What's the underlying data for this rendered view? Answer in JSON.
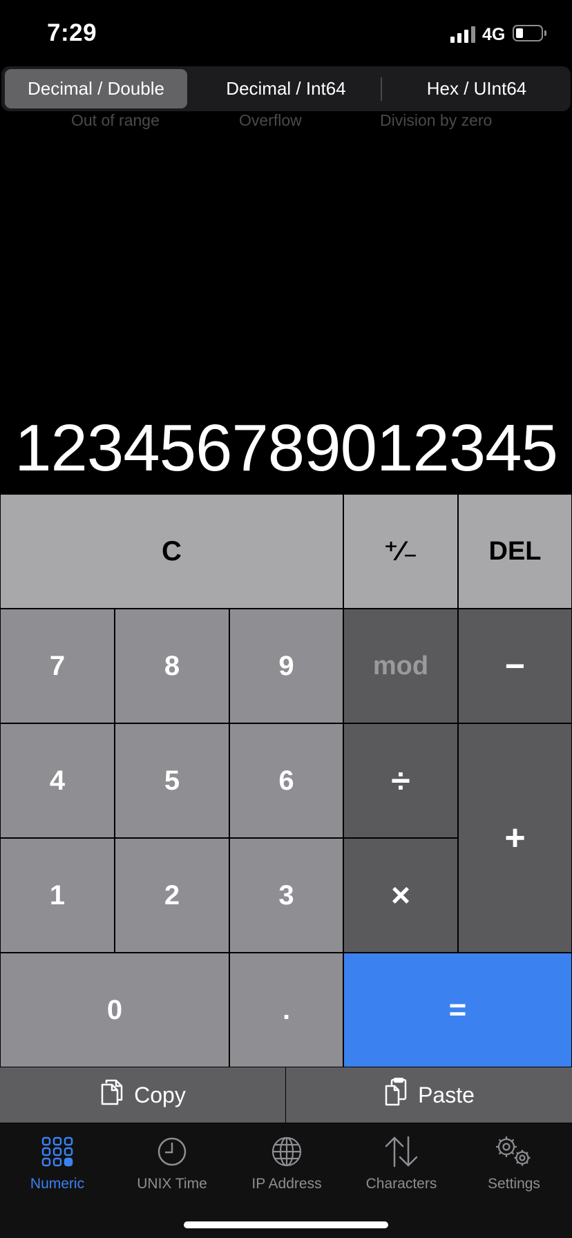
{
  "status_bar": {
    "time": "7:29",
    "network": "4G"
  },
  "segments": {
    "options": [
      "Decimal / Double",
      "Decimal / Int64",
      "Hex / UInt64"
    ],
    "selected": "Decimal / Double"
  },
  "errors": [
    "Out of range",
    "Overflow",
    "Division by zero"
  ],
  "display": {
    "value": "123456789012345"
  },
  "keys": {
    "clear": "C",
    "sign": "⁺∕₋",
    "del": "DEL",
    "seven": "7",
    "eight": "8",
    "nine": "9",
    "mod": "mod",
    "minus": "−",
    "four": "4",
    "five": "5",
    "six": "6",
    "divide": "÷",
    "plus": "+",
    "one": "1",
    "two": "2",
    "three": "3",
    "multiply": "×",
    "zero": "0",
    "dot": ".",
    "equals": "="
  },
  "actions": {
    "copy": "Copy",
    "paste": "Paste"
  },
  "tabs": [
    {
      "label": "Numeric",
      "icon": "grid-icon"
    },
    {
      "label": "UNIX Time",
      "icon": "clock-icon"
    },
    {
      "label": "IP Address",
      "icon": "globe-icon"
    },
    {
      "label": "Characters",
      "icon": "arrows-updown-icon"
    },
    {
      "label": "Settings",
      "icon": "gears-icon"
    }
  ],
  "active_tab": "Numeric",
  "colors": {
    "accent": "#3b82f0",
    "function_key": "#a8a8aa",
    "number_key": "#8e8e93",
    "operator_key": "#5a5a5c"
  }
}
